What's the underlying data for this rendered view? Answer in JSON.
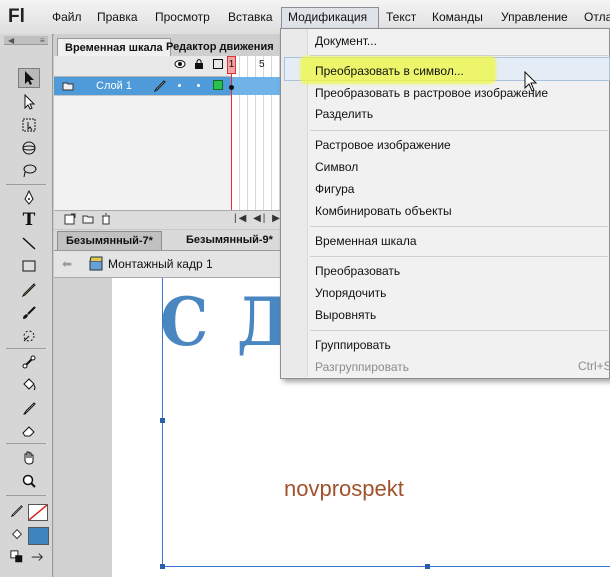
{
  "app": {
    "logo": "Fl"
  },
  "menubar": {
    "items": [
      "Файл",
      "Правка",
      "Просмотр",
      "Вставка",
      "Модификация",
      "Текст",
      "Команды",
      "Управление",
      "Отла"
    ]
  },
  "timeline_panel": {
    "tabs": [
      "Временная шкала",
      "Редактор движения"
    ],
    "active_tab": "Временная шкала",
    "frame_numbers": [
      "1",
      "5"
    ],
    "layer": {
      "name": "Слой 1",
      "selected": true
    }
  },
  "document": {
    "tabs": [
      "Безымянный-7*",
      "Безымянный-9*"
    ],
    "active_tab": "Безымянный-7*",
    "breadcrumb": "Монтажный кадр 1"
  },
  "stage": {
    "title_text": "С Дн",
    "watermark": "novprospekt"
  },
  "modify_menu": {
    "title": "Модификация",
    "groups": [
      [
        {
          "label": "Документ...",
          "enabled": true
        }
      ],
      [
        {
          "label": "Преобразовать в символ...",
          "enabled": true,
          "highlighted": true
        },
        {
          "label": "Преобразовать в растровое изображение",
          "enabled": true
        },
        {
          "label": "Разделить",
          "enabled": true
        }
      ],
      [
        {
          "label": "Растровое изображение",
          "enabled": true
        },
        {
          "label": "Символ",
          "enabled": true
        },
        {
          "label": "Фигура",
          "enabled": true
        },
        {
          "label": "Комбинировать объекты",
          "enabled": true
        }
      ],
      [
        {
          "label": "Временная шкала",
          "enabled": true
        }
      ],
      [
        {
          "label": "Преобразовать",
          "enabled": true
        },
        {
          "label": "Упорядочить",
          "enabled": true
        },
        {
          "label": "Выровнять",
          "enabled": true
        }
      ],
      [
        {
          "label": "Группировать",
          "enabled": true
        },
        {
          "label": "Разгруппировать",
          "enabled": false,
          "shortcut": "Ctrl+S"
        }
      ]
    ]
  },
  "colors": {
    "accent_selection": "#4f9bd9",
    "stage_title": "#4a86bf",
    "watermark": "#a0522d",
    "highlighter": "#f0f83c",
    "fill_swatch": "#3f86c1"
  }
}
